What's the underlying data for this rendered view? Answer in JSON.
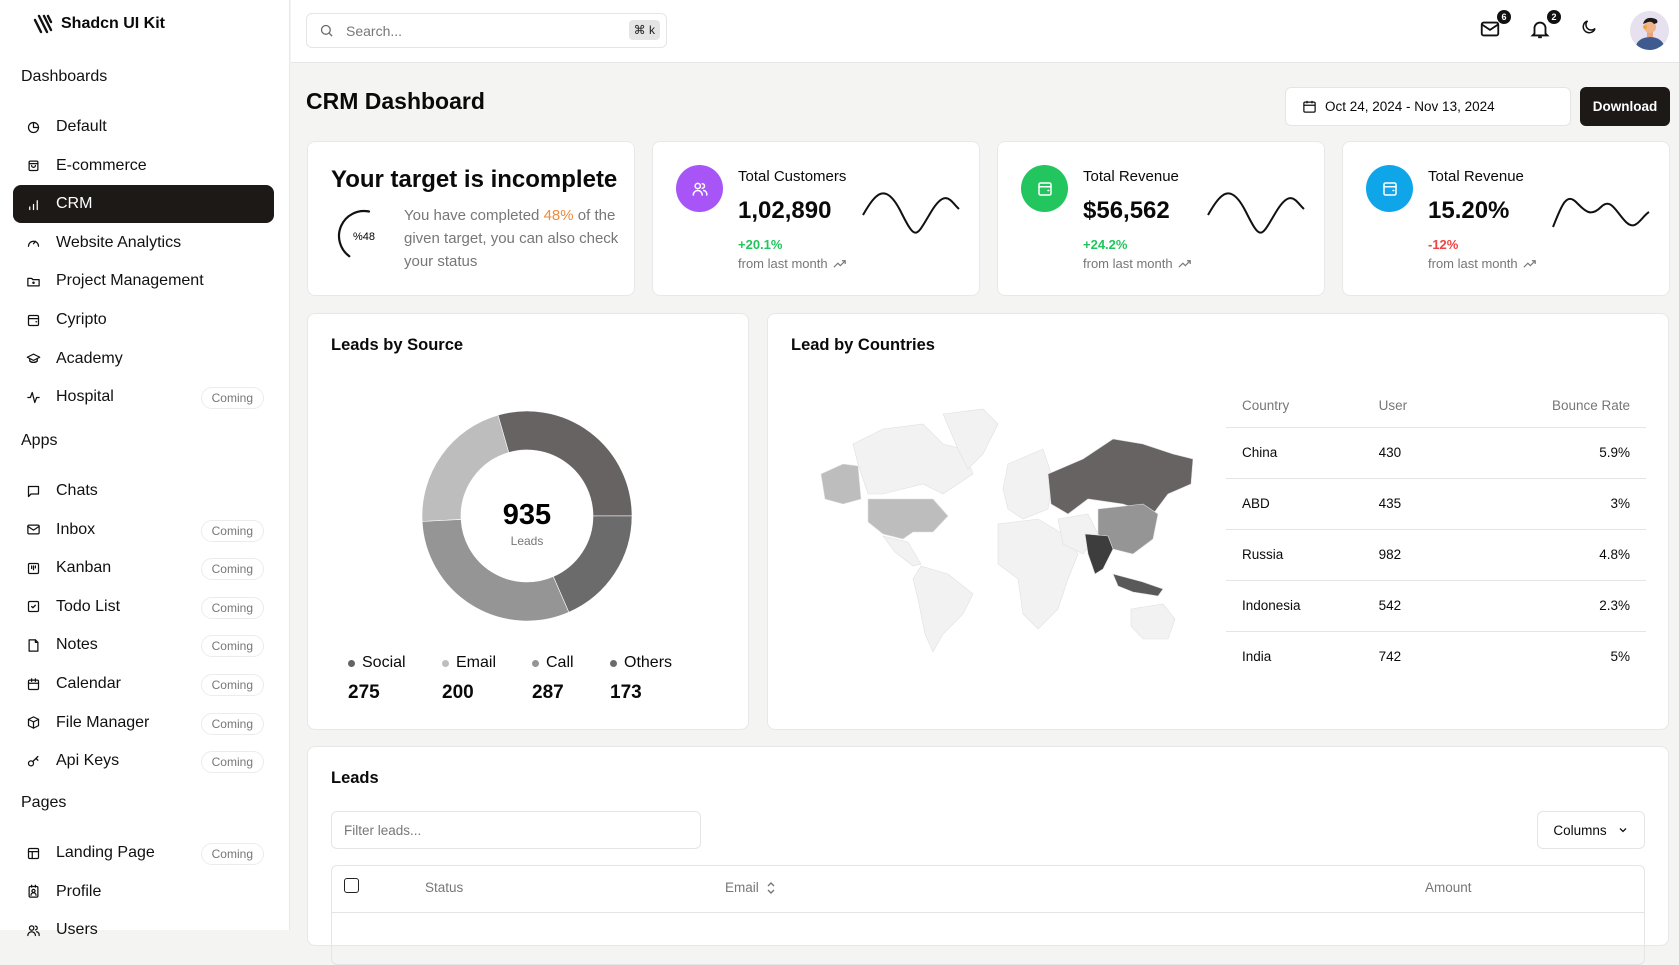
{
  "brand": {
    "name": "Shadcn UI Kit"
  },
  "sidebar": {
    "sections": [
      {
        "label": "Dashboards",
        "items": [
          {
            "label": "Default",
            "icon": "pie-chart-icon"
          },
          {
            "label": "E-commerce",
            "icon": "shopping-bag-icon"
          },
          {
            "label": "CRM",
            "icon": "bar-chart-icon",
            "active": true
          },
          {
            "label": "Website Analytics",
            "icon": "gauge-icon"
          },
          {
            "label": "Project Management",
            "icon": "folder-icon"
          },
          {
            "label": "Cyripto",
            "icon": "wallet-icon"
          },
          {
            "label": "Academy",
            "icon": "graduation-cap-icon"
          },
          {
            "label": "Hospital",
            "icon": "activity-icon",
            "badge": "Coming"
          }
        ]
      },
      {
        "label": "Apps",
        "items": [
          {
            "label": "Chats",
            "icon": "message-square-icon"
          },
          {
            "label": "Inbox",
            "icon": "mail-icon",
            "badge": "Coming"
          },
          {
            "label": "Kanban",
            "icon": "kanban-icon",
            "badge": "Coming"
          },
          {
            "label": "Todo List",
            "icon": "check-square-icon",
            "badge": "Coming"
          },
          {
            "label": "Notes",
            "icon": "file-icon",
            "badge": "Coming"
          },
          {
            "label": "Calendar",
            "icon": "calendar-icon",
            "badge": "Coming"
          },
          {
            "label": "File Manager",
            "icon": "package-icon",
            "badge": "Coming"
          },
          {
            "label": "Api Keys",
            "icon": "key-icon",
            "badge": "Coming"
          }
        ]
      },
      {
        "label": "Pages",
        "items": [
          {
            "label": "Landing Page",
            "icon": "layout-icon",
            "badge": "Coming"
          },
          {
            "label": "Profile",
            "icon": "id-badge-icon"
          },
          {
            "label": "Users",
            "icon": "users-icon"
          }
        ]
      }
    ]
  },
  "header": {
    "search_placeholder": "Search...",
    "shortcut": "⌘ k",
    "mail_count": "6",
    "notification_count": "2"
  },
  "page": {
    "title": "CRM Dashboard",
    "date_range": "Oct 24, 2024 - Nov 13, 2024",
    "download_label": "Download"
  },
  "target": {
    "title": "Your target is incomplete",
    "gauge_label": "%48",
    "progress_percent": 48,
    "text_before": "You have completed ",
    "highlight": "48%",
    "text_after": " of the given target, you can also check your status"
  },
  "stats": [
    {
      "label": "Total Customers",
      "value": "1,02,890",
      "change": "+20.1%",
      "trend": "up",
      "from": "from last month",
      "color": "#a855f7",
      "icon": "users-icon"
    },
    {
      "label": "Total Revenue",
      "value": "$56,562",
      "change": "+24.2%",
      "trend": "up",
      "from": "from last month",
      "color": "#22c55e",
      "icon": "wallet-icon"
    },
    {
      "label": "Total Revenue",
      "value": "15.20%",
      "change": "-12%",
      "trend": "down",
      "from": "from last month",
      "color": "#0ea5e9",
      "icon": "wallet-icon"
    }
  ],
  "leads_by_source": {
    "title": "Leads by Source",
    "total": "935",
    "total_label": "Leads"
  },
  "chart_data": {
    "type": "pie",
    "title": "Leads by Source",
    "categories": [
      "Social",
      "Email",
      "Call",
      "Others"
    ],
    "values": [
      275,
      200,
      287,
      173
    ],
    "colors": [
      "#666362",
      "#bdbdbd",
      "#959595",
      "#6b6b6b"
    ],
    "total": 935,
    "legend": "bottom"
  },
  "countries": {
    "title": "Lead by Countries",
    "columns": [
      "Country",
      "User",
      "Bounce Rate"
    ],
    "rows": [
      {
        "country": "China",
        "user": "430",
        "bounce": "5.9%"
      },
      {
        "country": "ABD",
        "user": "435",
        "bounce": "3%"
      },
      {
        "country": "Russia",
        "user": "982",
        "bounce": "4.8%"
      },
      {
        "country": "Indonesia",
        "user": "542",
        "bounce": "2.3%"
      },
      {
        "country": "India",
        "user": "742",
        "bounce": "5%"
      }
    ]
  },
  "leads": {
    "title": "Leads",
    "filter_placeholder": "Filter leads...",
    "columns_label": "Columns",
    "headers": [
      "Status",
      "Email",
      "Amount"
    ]
  }
}
